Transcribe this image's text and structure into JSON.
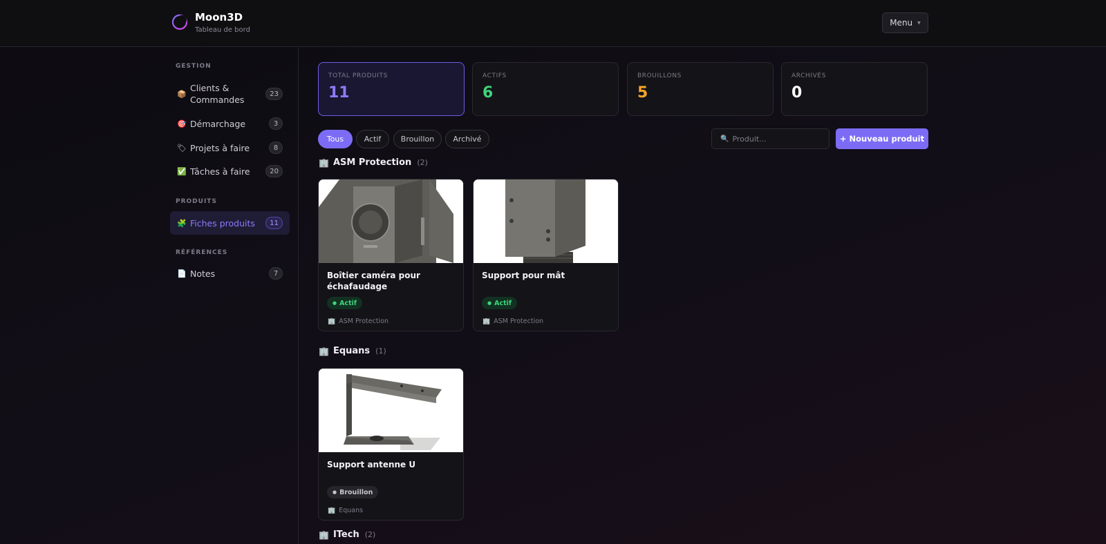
{
  "header": {
    "brand": "Moon3D",
    "subtitle": "Tableau de bord",
    "menu_label": "Menu"
  },
  "sidebar": {
    "sections": [
      {
        "label": "GESTION"
      },
      {
        "label": "PRODUITS"
      },
      {
        "label": "RÉFÉRENCES"
      }
    ],
    "items": [
      {
        "icon": "📦",
        "label": "Clients & Commandes",
        "count": "23"
      },
      {
        "icon": "🎯",
        "label": "Démarchage",
        "count": "3"
      },
      {
        "icon": "🏷",
        "label": "Projets à faire",
        "count": "8"
      },
      {
        "icon": "✅",
        "label": "Tâches à faire",
        "count": "20"
      },
      {
        "icon": "🧩",
        "label": "Fiches produits",
        "count": "11"
      },
      {
        "icon": "📄",
        "label": "Notes",
        "count": "7"
      }
    ]
  },
  "stats": [
    {
      "label": "TOTAL PRODUITS",
      "value": "11",
      "color": "#8b7cff"
    },
    {
      "label": "ACTIFS",
      "value": "6",
      "color": "#3fd47a"
    },
    {
      "label": "BROUILLONS",
      "value": "5",
      "color": "#f5a524"
    },
    {
      "label": "ARCHIVÉS",
      "value": "0",
      "color": "#ffffff"
    }
  ],
  "filters": [
    "Tous",
    "Actif",
    "Brouillon",
    "Archivé"
  ],
  "search": {
    "placeholder": "Produit...",
    "icon": "🔍"
  },
  "new_button": "+ Nouveau produit",
  "groups": [
    {
      "icon": "🏢",
      "name": "ASM Protection",
      "count": "(2)"
    },
    {
      "icon": "🏢",
      "name": "Equans",
      "count": "(1)"
    },
    {
      "icon": "🏢",
      "name": "ITech",
      "count": "(2)"
    }
  ],
  "products": [
    {
      "title": "Boîtier caméra pour échafaudage",
      "status": "Actif",
      "client": "ASM Protection"
    },
    {
      "title": "Support pour mât",
      "status": "Actif",
      "client": "ASM Protection"
    },
    {
      "title": "Support antenne U",
      "status": "Brouillon",
      "client": "Equans"
    }
  ],
  "client_icon": "🏢",
  "status_dot": "●"
}
